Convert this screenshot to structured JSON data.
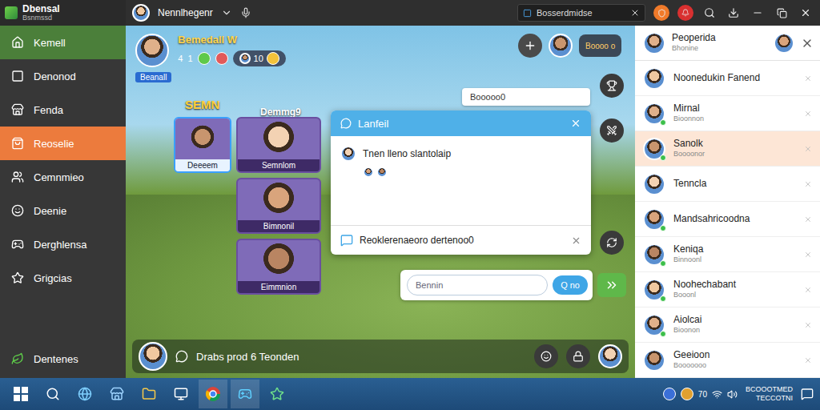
{
  "logo": {
    "title": "Dbensal",
    "subtitle": "Bsnmssd"
  },
  "sidebar": {
    "items": [
      {
        "label": "Kemell",
        "kind": "home",
        "selected": false
      },
      {
        "label": "Denonod",
        "kind": "plain",
        "selected": false
      },
      {
        "label": "Fenda",
        "kind": "plain",
        "selected": false
      },
      {
        "label": "Reoselie",
        "kind": "plain",
        "selected": true
      },
      {
        "label": "Cemnmieo",
        "kind": "plain",
        "selected": false
      },
      {
        "label": "Deenie",
        "kind": "plain",
        "selected": false
      },
      {
        "label": "Derghlensa",
        "kind": "plain",
        "selected": false
      },
      {
        "label": "Grigcias",
        "kind": "plain",
        "selected": false
      }
    ],
    "footer": "Dentenes"
  },
  "topbar": {
    "user": "Nennlhegenr",
    "search": "Bosserdmidse"
  },
  "game": {
    "player": {
      "name": "Bemedall W",
      "badge": "Beanall",
      "stats": [
        "4",
        "1"
      ],
      "coins": "10"
    },
    "labels": [
      "SEMN",
      "Demmg9"
    ],
    "cards": [
      {
        "name": "Deeeem",
        "selected": true
      },
      {
        "name": "Semnlom",
        "selected": false
      },
      {
        "name": "Bimnonil",
        "selected": false
      },
      {
        "name": "Eimmnion",
        "selected": false
      }
    ],
    "hint": "Booooo0",
    "chat": {
      "title": "Lanfeil",
      "message": "Tnen lleno slantolaip",
      "footer": "Reoklerenaeoro dertenoo0"
    },
    "input": {
      "placeholder": "Bennin",
      "button": "Q no"
    },
    "score": "Boooo o",
    "bottom": "Drabs prod 6 Teonden"
  },
  "friends": {
    "title": "Peoperida",
    "subtitle": "Bhonine",
    "items": [
      {
        "name": "Noonedukin Fanend",
        "online": false,
        "selected": false
      },
      {
        "name": "Mirnal",
        "status": "Bioonnon",
        "online": true,
        "selected": false
      },
      {
        "name": "Sanolk",
        "status": "Boooonor",
        "online": true,
        "selected": true
      },
      {
        "name": "Tenncla",
        "online": false,
        "selected": false
      },
      {
        "name": "Mandsahricoodna",
        "online": true,
        "selected": false
      },
      {
        "name": "Keniqa",
        "status": "Binnoonl",
        "online": true,
        "selected": false
      },
      {
        "name": "Noohechabant",
        "status": "Booonl",
        "online": true,
        "selected": false
      },
      {
        "name": "Aiolcai",
        "status": "Bioonon",
        "online": true,
        "selected": false
      },
      {
        "name": "Geeioon",
        "status": "Booooooo",
        "online": false,
        "selected": false
      }
    ]
  },
  "taskbar": {
    "tray": "70",
    "time": "BCOOOTMED",
    "date": "TECCOTNI"
  }
}
